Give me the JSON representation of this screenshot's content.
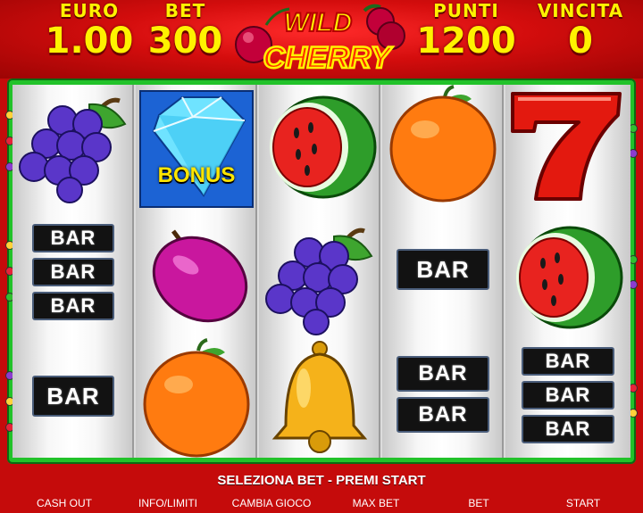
{
  "header": {
    "euro_label": "EURO",
    "euro_value": "1.00",
    "bet_label": "BET",
    "bet_value": "300",
    "punti_label": "PUNTI",
    "punti_value": "1200",
    "vincita_label": "VINCITA",
    "vincita_value": "0"
  },
  "logo": {
    "line1": "WILD",
    "line2": "CHERRY"
  },
  "reels": [
    [
      "grapes-icon",
      "bar x3",
      "bar x1"
    ],
    [
      "diamond-bonus-icon",
      "plum-icon",
      "orange-icon"
    ],
    [
      "watermelon-icon",
      "grapes-icon",
      "bell-icon"
    ],
    [
      "orange-icon",
      "bar x1",
      "bar x2"
    ],
    [
      "seven-icon",
      "watermelon-icon",
      "bar x3"
    ]
  ],
  "symbols": {
    "bar_label": "BAR",
    "bonus_label": "BONUS"
  },
  "colors": {
    "frame": "#22c22a",
    "header": "#d40d0d",
    "value": "#fff200"
  },
  "message": "SELEZIONA BET - PREMI START",
  "buttons": {
    "cash_out": "CASH OUT",
    "info": "INFO/LIMITI",
    "change_game": "CAMBIA GIOCO",
    "max_bet": "MAX BET",
    "bet": "BET",
    "start": "START"
  }
}
